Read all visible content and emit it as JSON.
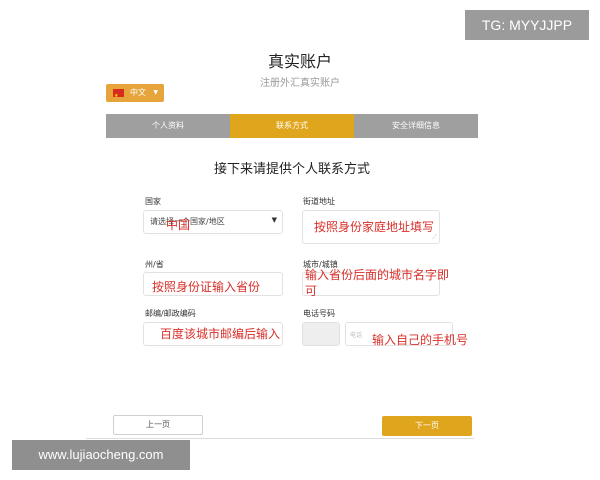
{
  "watermark_top": "TG: MYYJJPP",
  "watermark_bottom": "www.lujiaocheng.com",
  "header": {
    "title": "真实账户",
    "subtitle": "注册外汇真实账户"
  },
  "language": {
    "label": "中文",
    "icon": "china-flag-icon"
  },
  "steps": [
    "个人资料",
    "联系方式",
    "安全详细信息"
  ],
  "active_step": 1,
  "form": {
    "heading": "接下来请提供个人联系方式",
    "country": {
      "label": "国家",
      "placeholder": "请选择一个国家/地区",
      "note": "中国"
    },
    "street": {
      "label": "街道地址",
      "note": "按照身份家庭地址填写"
    },
    "province": {
      "label": "州/省",
      "note": "按照身份证输入省份"
    },
    "city": {
      "label": "城市/城镇",
      "note_line1": "输入省份后面的城市名字即",
      "note_line2": "可"
    },
    "postal": {
      "label": "邮编/邮政编码",
      "note": "百度该城市邮编后输入"
    },
    "phone": {
      "label": "电话号码",
      "placeholder": "电话",
      "note": "输入自己的手机号"
    }
  },
  "buttons": {
    "prev": "上一页",
    "next": "下一页"
  },
  "colors": {
    "accent": "#dfa51c",
    "step_inactive": "#9f9f9f",
    "annotation": "#d9302a"
  }
}
